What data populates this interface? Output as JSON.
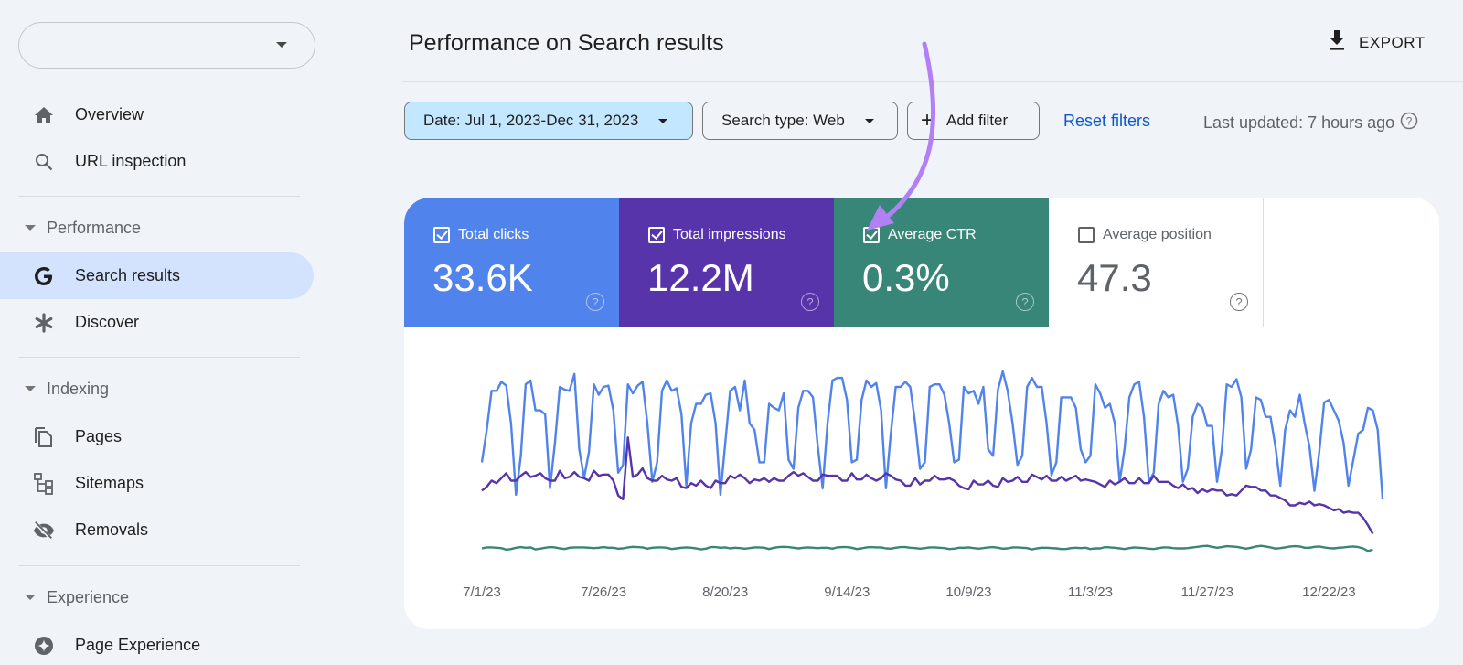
{
  "sidebar": {
    "property_selector": {
      "value": ""
    },
    "items": [
      {
        "label": "Overview",
        "icon": "home-icon"
      },
      {
        "label": "URL inspection",
        "icon": "search-icon"
      }
    ],
    "sections": [
      {
        "label": "Performance",
        "items": [
          {
            "label": "Search results",
            "icon": "google-g-icon",
            "active": true
          },
          {
            "label": "Discover",
            "icon": "asterisk-icon"
          }
        ]
      },
      {
        "label": "Indexing",
        "items": [
          {
            "label": "Pages",
            "icon": "pages-icon"
          },
          {
            "label": "Sitemaps",
            "icon": "sitemap-icon"
          },
          {
            "label": "Removals",
            "icon": "eye-off-icon"
          }
        ]
      },
      {
        "label": "Experience",
        "items": [
          {
            "label": "Page Experience",
            "icon": "page-experience-icon"
          }
        ]
      }
    ]
  },
  "header": {
    "title": "Performance on Search results",
    "export_label": "EXPORT"
  },
  "filters": {
    "date": "Date: Jul 1, 2023-Dec 31, 2023",
    "search_type": "Search type: Web",
    "add_filter": "Add filter",
    "reset": "Reset filters",
    "last_updated": "Last updated: 7 hours ago"
  },
  "metrics": [
    {
      "label": "Total clicks",
      "value": "33.6K",
      "checked": true,
      "color": "#5083ec"
    },
    {
      "label": "Total impressions",
      "value": "12.2M",
      "checked": true,
      "color": "#5734a9"
    },
    {
      "label": "Average CTR",
      "value": "0.3%",
      "checked": true,
      "color": "#388677"
    },
    {
      "label": "Average position",
      "value": "47.3",
      "checked": false,
      "color": "#ffffff"
    }
  ],
  "annotation": {
    "type": "arrow",
    "color": "#b27ff5",
    "points_to": "Average CTR checkbox"
  },
  "chart_data": {
    "type": "line",
    "title": "",
    "xlabel": "",
    "ylabel": "",
    "x_start": "7/1/23",
    "x_end": "12/31/23",
    "x_tick_labels": [
      "7/1/23",
      "7/26/23",
      "8/20/23",
      "9/14/23",
      "10/9/23",
      "11/3/23",
      "11/27/23",
      "12/22/23"
    ],
    "x_tick_day_index": [
      0,
      25,
      50,
      75,
      100,
      125,
      149,
      174
    ],
    "y_axis_visible": false,
    "grid": false,
    "value_scale": "relative (0-100, each series independently scaled, no axis shown)",
    "series": [
      {
        "name": "Total clicks",
        "color": "#5083ec",
        "values": [
          30,
          55,
          85,
          85,
          92,
          89,
          60,
          5,
          35,
          90,
          93,
          70,
          70,
          67,
          10,
          45,
          88,
          86,
          85,
          98,
          40,
          18,
          38,
          90,
          82,
          88,
          89,
          70,
          22,
          28,
          90,
          83,
          89,
          92,
          60,
          15,
          30,
          85,
          93,
          85,
          87,
          67,
          12,
          60,
          75,
          75,
          82,
          83,
          60,
          5,
          45,
          85,
          88,
          70,
          93,
          60,
          55,
          30,
          30,
          75,
          72,
          70,
          83,
          32,
          25,
          72,
          85,
          85,
          80,
          42,
          10,
          60,
          93,
          95,
          95,
          78,
          30,
          32,
          78,
          93,
          88,
          91,
          70,
          10,
          52,
          88,
          88,
          92,
          88,
          60,
          25,
          30,
          88,
          90,
          90,
          82,
          60,
          30,
          32,
          88,
          83,
          85,
          75,
          88,
          40,
          35,
          86,
          100,
          85,
          60,
          28,
          35,
          88,
          95,
          88,
          88,
          60,
          20,
          30,
          80,
          80,
          80,
          72,
          40,
          30,
          35,
          90,
          83,
          72,
          75,
          60,
          15,
          40,
          80,
          90,
          92,
          65,
          15,
          22,
          75,
          85,
          80,
          82,
          58,
          15,
          25,
          65,
          75,
          72,
          58,
          58,
          15,
          40,
          90,
          88,
          94,
          80,
          25,
          40,
          80,
          78,
          65,
          65,
          42,
          12,
          55,
          70,
          65,
          82,
          60,
          42,
          8,
          38,
          76,
          78,
          70,
          62,
          45,
          12,
          32,
          52,
          55,
          72,
          70,
          55,
          2
        ]
      },
      {
        "name": "Total impressions",
        "color": "#5734a9",
        "values": [
          42,
          45,
          50,
          48,
          52,
          56,
          50,
          50,
          54,
          57,
          53,
          54,
          56,
          52,
          50,
          50,
          58,
          52,
          53,
          57,
          53,
          52,
          50,
          58,
          54,
          55,
          55,
          50,
          38,
          35,
          85,
          53,
          55,
          60,
          52,
          50,
          50,
          54,
          51,
          50,
          52,
          45,
          44,
          48,
          46,
          50,
          46,
          44,
          50,
          48,
          48,
          54,
          52,
          55,
          52,
          48,
          51,
          50,
          52,
          49,
          52,
          50,
          50,
          54,
          57,
          54,
          56,
          53,
          50,
          50,
          55,
          54,
          54,
          54,
          50,
          50,
          56,
          51,
          51,
          55,
          52,
          50,
          52,
          56,
          54,
          51,
          50,
          46,
          46,
          52,
          47,
          50,
          50,
          54,
          51,
          51,
          52,
          50,
          46,
          44,
          43,
          50,
          47,
          47,
          50,
          46,
          45,
          52,
          49,
          50,
          53,
          49,
          49,
          55,
          53,
          51,
          54,
          50,
          50,
          53,
          50,
          52,
          54,
          50,
          51,
          50,
          49,
          47,
          45,
          50,
          47,
          49,
          52,
          48,
          48,
          52,
          48,
          48,
          54,
          49,
          49,
          49,
          46,
          44,
          47,
          43,
          44,
          40,
          43,
          41,
          43,
          42,
          42,
          38,
          39,
          38,
          42,
          46,
          45,
          45,
          42,
          42,
          38,
          38,
          36,
          34,
          30,
          30,
          32,
          31,
          33,
          30,
          31,
          30,
          28,
          26,
          27,
          24,
          25,
          24,
          24,
          20,
          14,
          7
        ]
      },
      {
        "name": "Average CTR",
        "color": "#388677",
        "values": [
          10,
          13,
          13,
          12,
          11,
          6,
          8,
          12,
          14,
          12,
          13,
          7,
          9,
          12,
          14,
          13,
          10,
          8,
          12,
          13,
          13,
          13,
          12,
          11,
          12,
          14,
          12,
          12,
          9,
          10,
          13,
          15,
          14,
          13,
          9,
          12,
          13,
          13,
          12,
          8,
          10,
          12,
          13,
          12,
          10,
          7,
          9,
          14,
          14,
          12,
          13,
          10,
          12,
          11,
          9,
          11,
          13,
          13,
          12,
          8,
          12,
          14,
          15,
          14,
          12,
          10,
          12,
          13,
          12,
          11,
          12,
          12,
          9,
          13,
          14,
          14,
          12,
          8,
          10,
          13,
          14,
          13,
          13,
          10,
          9,
          12,
          14,
          14,
          12,
          11,
          9,
          11,
          13,
          13,
          12,
          11,
          8,
          9,
          12,
          12,
          13,
          11,
          9,
          11,
          13,
          14,
          12,
          9,
          10,
          13,
          13,
          12,
          11,
          7,
          10,
          12,
          12,
          11,
          10,
          8,
          8,
          11,
          12,
          11,
          12,
          8,
          10,
          10,
          14,
          13,
          12,
          10,
          8,
          11,
          13,
          12,
          11,
          9,
          8,
          11,
          13,
          13,
          11,
          10,
          10,
          11,
          13,
          15,
          17,
          18,
          15,
          12,
          14,
          17,
          16,
          15,
          12,
          9,
          12,
          16,
          18,
          16,
          13,
          9,
          11,
          13,
          16,
          17,
          16,
          12,
          12,
          15,
          16,
          13,
          11,
          10,
          12,
          13,
          15,
          16,
          14,
          10,
          2,
          6
        ]
      }
    ]
  }
}
